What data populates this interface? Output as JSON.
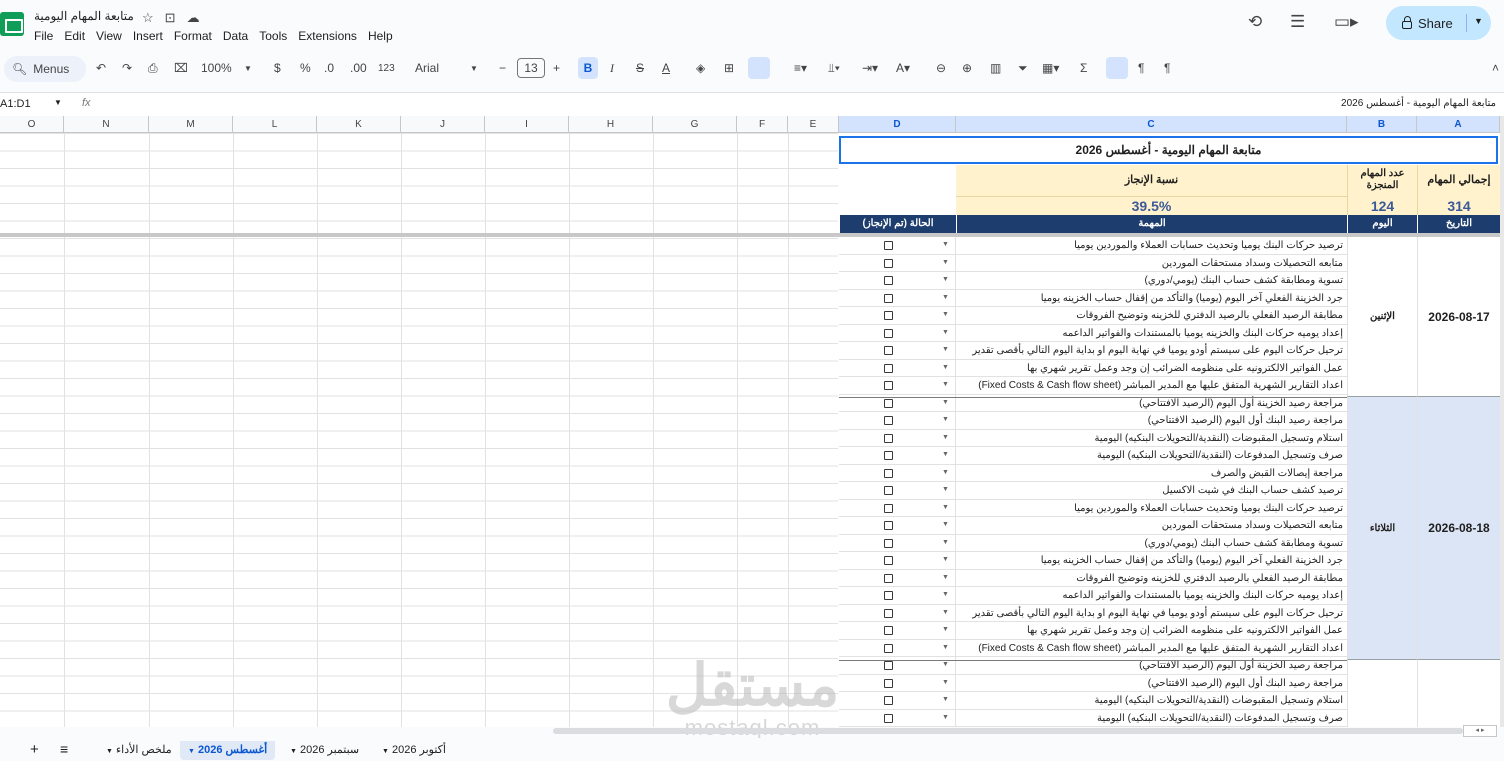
{
  "app": {
    "doc_title": "متابعة المهام اليومية",
    "menu": [
      "File",
      "Edit",
      "View",
      "Insert",
      "Format",
      "Data",
      "Tools",
      "Extensions",
      "Help"
    ],
    "share_label": "Share"
  },
  "toolbar": {
    "menus_label": "Menus",
    "zoom": "100%",
    "currency": "$",
    "percent": "%",
    "dec_less": ".0",
    "dec_more": ".00",
    "format_123": "123",
    "font": "Arial",
    "font_size": "13"
  },
  "formula_bar": {
    "name_box": "A1:D1",
    "fx": "fx",
    "value": "متابعة المهام اليومية - أغسطس 2026"
  },
  "columns": [
    "O",
    "N",
    "M",
    "L",
    "K",
    "J",
    "I",
    "H",
    "G",
    "F",
    "E",
    "D",
    "C",
    "B",
    "A"
  ],
  "sheet": {
    "title": "متابعة المهام اليومية - أغسطس 2026",
    "label_rate": "نسبة الإنجاز",
    "label_done": "عدد المهام المنجزة",
    "label_total": "إجمالي المهام",
    "rate": "39.5%",
    "done": "124",
    "total": "314",
    "hdr_status": "الحالة (تم الإنجاز)",
    "hdr_task": "المهمة",
    "hdr_day": "اليوم",
    "hdr_date": "التاريخ"
  },
  "days": [
    {
      "day": "الإثنين",
      "date": "2026-08-17"
    },
    {
      "day": "الثلاثاء",
      "date": "2026-08-18"
    }
  ],
  "tasks": [
    "ترصيد حركات البنك يوميا وتحديث حسابات العملاء والموردين يوميا",
    "متابعه التحصيلات وسداد مستحقات الموردين",
    "تسوية ومطابقة كشف حساب البنك (يومي/دوري)",
    "جرد الخزينة الفعلي آخر اليوم (يوميا) والتأكد من إقفال حساب الخزينه يوميا",
    "مطابقة الرصيد الفعلي بالرصيد الدفتري للخزينه وتوضيح الفروقات",
    "إعداد يوميه حركات البنك والخزينه يوميا بالمستندات والفواتير الداعمه",
    "ترحيل حركات اليوم على سيستم أودو يوميا في نهاية اليوم او بداية اليوم التالي بأقصى تقدير",
    "عمل الفواتير الالكترونيه على منظومه الضرائب إن وجد وعمل تقرير شهري بها",
    "اعداد التقارير الشهرية المتفق عليها مع المدير المباشر (Fixed Costs & Cash flow sheet)",
    "مراجعة رصيد الخزينة أول اليوم (الرصيد الافتتاحي)",
    "مراجعة رصيد البنك أول اليوم (الرصيد الافتتاحي)",
    "استلام وتسجيل المقبوضات (النقدية/التحويلات البنكيه) اليومية",
    "صرف وتسجيل المدفوعات (النقدية/التحويلات البنكيه) اليومية",
    "مراجعة إيصالات القبض والصرف",
    "ترصيد كشف حساب البنك في شيت الاكسيل",
    "ترصيد حركات البنك يوميا وتحديث حسابات العملاء والموردين يوميا",
    "متابعه التحصيلات وسداد مستحقات الموردين",
    "تسوية ومطابقة كشف حساب البنك (يومي/دوري)",
    "جرد الخزينة الفعلي آخر اليوم (يوميا) والتأكد من إقفال حساب الخزينه يوميا",
    "مطابقة الرصيد الفعلي بالرصيد الدفتري للخزينه وتوضيح الفروقات",
    "إعداد يوميه حركات البنك والخزينه يوميا بالمستندات والفواتير الداعمه",
    "ترحيل حركات اليوم على سيستم أودو يوميا في نهاية اليوم او بداية اليوم التالي بأقصى تقدير",
    "عمل الفواتير الالكترونيه على منظومه الضرائب إن وجد وعمل تقرير شهري بها",
    "اعداد التقارير الشهرية المتفق عليها مع المدير المباشر (Fixed Costs & Cash flow sheet)",
    "مراجعة رصيد الخزينة أول اليوم (الرصيد الافتتاحي)",
    "مراجعة رصيد البنك أول اليوم (الرصيد الافتتاحي)",
    "استلام وتسجيل المقبوضات (النقدية/التحويلات البنكيه) اليومية",
    "صرف وتسجيل المدفوعات (النقدية/التحويلات البنكيه) اليومية"
  ],
  "tabs": [
    "ملخص الأداء",
    "أغسطس 2026",
    "سبتمبر 2026",
    "أكتوبر 2026"
  ],
  "watermark": {
    "ar": "مستقل",
    "en": "mostaql.com"
  }
}
